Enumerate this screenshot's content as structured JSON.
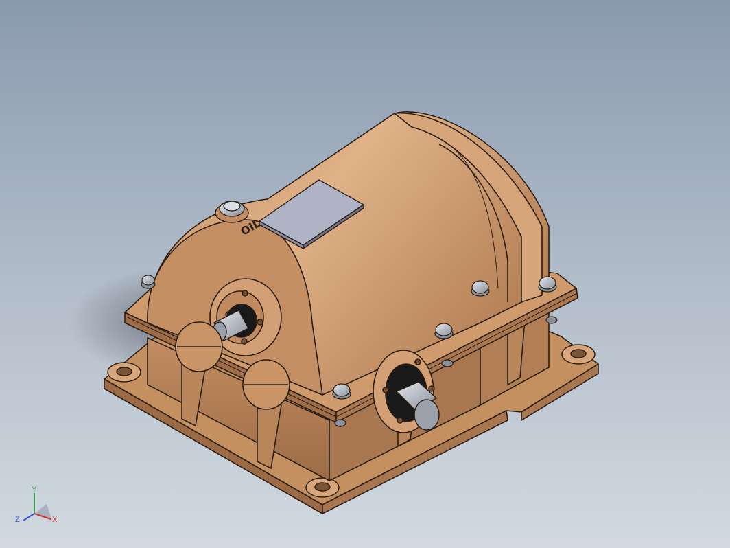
{
  "model": {
    "name_plate_text": "",
    "engraving": "OIL",
    "colors": {
      "housing": "#c89468",
      "housing_light": "#d9a67a",
      "housing_dark": "#9c6b45",
      "edge": "#2a1d14",
      "steel": "#b8bec6",
      "nameplate": "#aeb4c6"
    }
  },
  "triad": {
    "x_label": "X",
    "y_label": "Y",
    "z_label": "Z",
    "colors": {
      "x": "#d0342c",
      "y": "#3aa34a",
      "z": "#2f55c8"
    }
  }
}
